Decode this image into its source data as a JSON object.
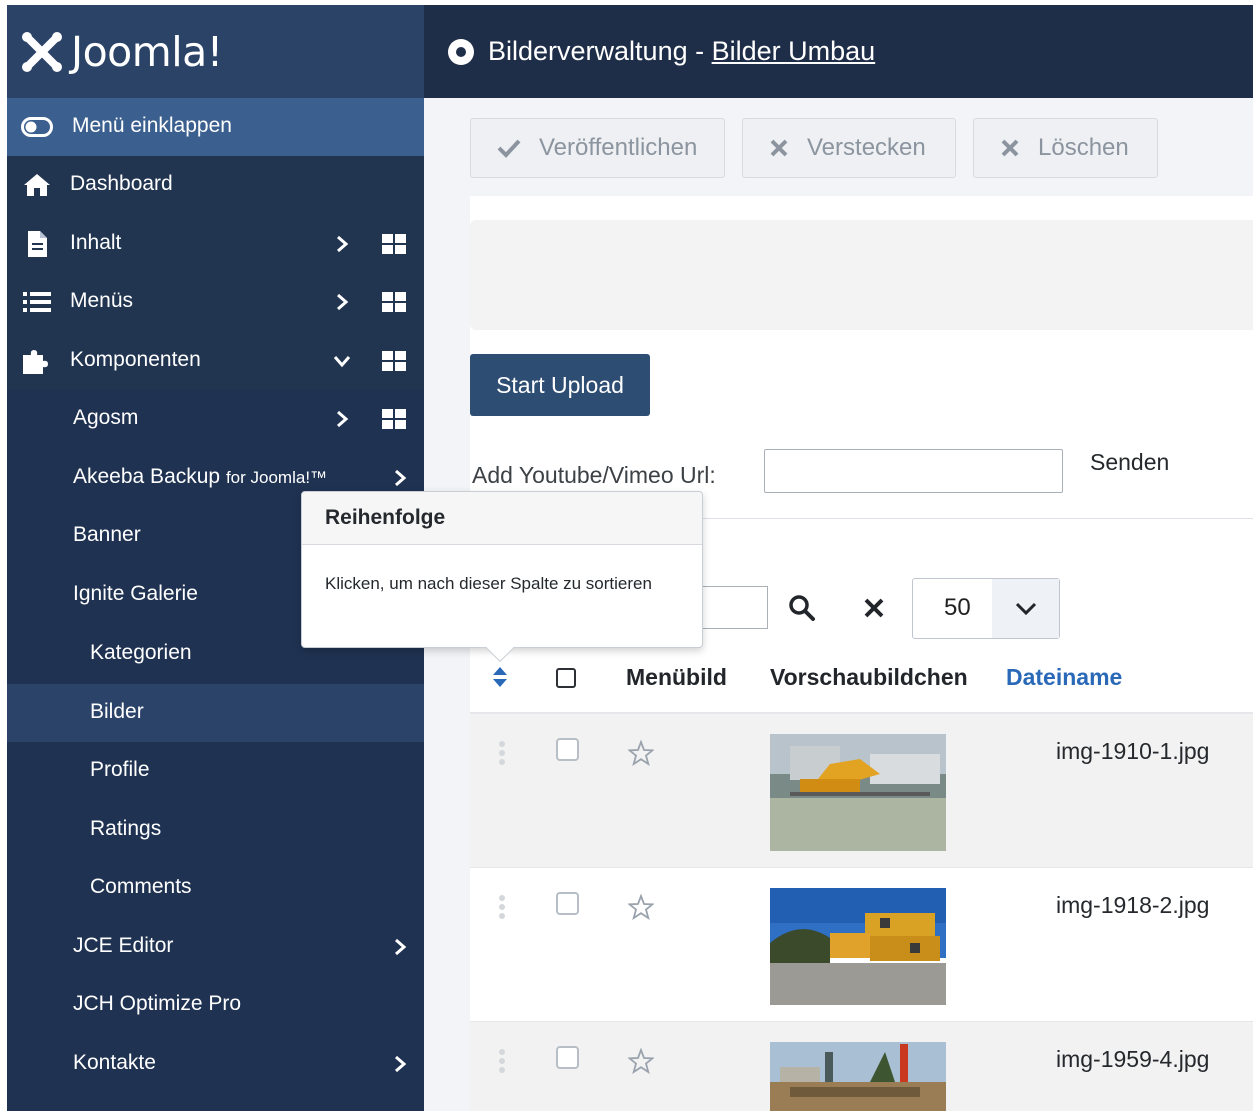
{
  "brand": {
    "name": "Joomla!"
  },
  "header": {
    "title_prefix": "Bilderverwaltung - ",
    "title_link": "Bilder Umbau"
  },
  "sidebar": {
    "collapse": "Menü einklappen",
    "items": [
      {
        "label": "Dashboard"
      },
      {
        "label": "Inhalt"
      },
      {
        "label": "Menüs"
      },
      {
        "label": "Komponenten"
      },
      {
        "label": "Agosm"
      },
      {
        "label": "Akeeba Backup",
        "suffix": "for Joomla!™"
      },
      {
        "label": "Banner"
      },
      {
        "label": "Ignite Galerie"
      },
      {
        "label": "Kategorien"
      },
      {
        "label": "Bilder"
      },
      {
        "label": "Profile"
      },
      {
        "label": "Ratings"
      },
      {
        "label": "Comments"
      },
      {
        "label": "JCE Editor"
      },
      {
        "label": "JCH Optimize Pro"
      },
      {
        "label": "Kontakte"
      }
    ]
  },
  "toolbar": {
    "publish": "Veröffentlichen",
    "hide": "Verstecken",
    "delete": "Löschen"
  },
  "upload": {
    "start": "Start Upload",
    "youtube_label": "Add Youtube/Vimeo Url:",
    "youtube_value": "",
    "send": "Senden"
  },
  "filter": {
    "search_value": "",
    "limit": "50"
  },
  "table": {
    "headers": {
      "menu_image": "Menübild",
      "thumbnail": "Vorschaubildchen",
      "filename": "Dateiname"
    },
    "rows": [
      {
        "filename": "img-1910-1.jpg"
      },
      {
        "filename": "img-1918-2.jpg"
      },
      {
        "filename": "img-1959-4.jpg"
      }
    ]
  },
  "tooltip": {
    "title": "Reihenfolge",
    "text": "Klicken, um nach dieser Spalte zu sortieren"
  },
  "colors": {
    "sidebar_bg": "#213450",
    "sidebar_active": "#2a4366",
    "header_bg": "#1f2e48",
    "primary_button": "#2e4d73",
    "link_blue": "#2a69b8"
  }
}
